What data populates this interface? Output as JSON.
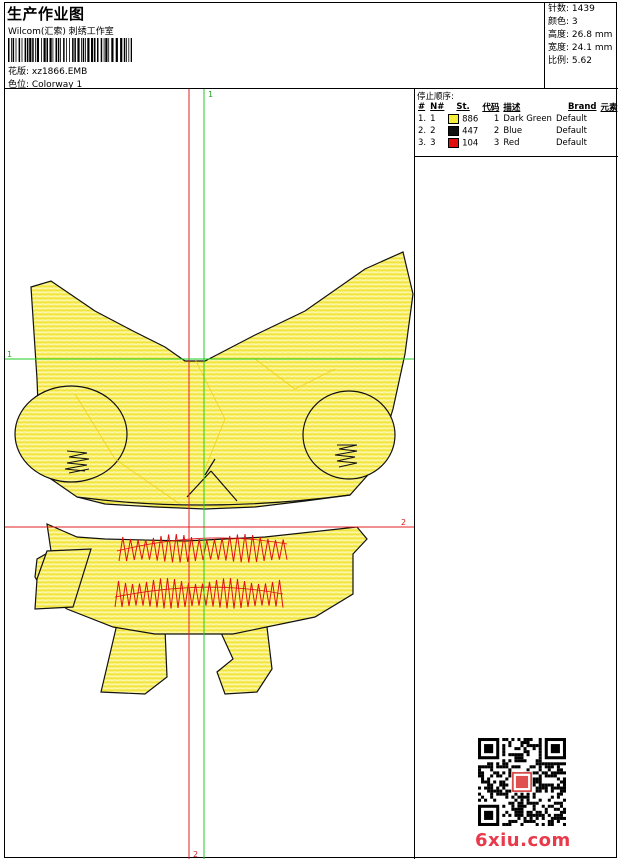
{
  "header": {
    "title": "生产作业图",
    "company": "Wilcom(汇索) 刺绣工作室",
    "design_line": "花版: xz1866.EMB",
    "colorway_line": "色位: Colorway 1"
  },
  "stats": [
    {
      "label": "针数",
      "value": "1439"
    },
    {
      "label": "颜色",
      "value": "3"
    },
    {
      "label": "高度",
      "value": "26.8 mm"
    },
    {
      "label": "宽度",
      "value": "24.1 mm"
    },
    {
      "label": "比例",
      "value": "5.62"
    }
  ],
  "stop_sequence": {
    "title": "停止顺序:",
    "columns": [
      "#",
      "N#",
      "St.",
      "代码",
      "描述",
      "Brand",
      "元素"
    ],
    "rows": [
      {
        "num": "1.",
        "n": "1",
        "color": "#f5ee3a",
        "st": "886",
        "code": "1",
        "desc": "Dark Green",
        "brand": "Default"
      },
      {
        "num": "2.",
        "n": "2",
        "color": "#111111",
        "st": "447",
        "code": "2",
        "desc": "Blue",
        "brand": "Default"
      },
      {
        "num": "3.",
        "n": "3",
        "color": "#e01010",
        "st": "104",
        "code": "3",
        "desc": "Red",
        "brand": "Default"
      }
    ]
  },
  "guides": {
    "label_1": "1",
    "label_2": "2"
  },
  "watermark": "6xiu.com",
  "colors": {
    "fill": "#f7ee6a",
    "stitch": "#f1e33a",
    "outline": "#111111",
    "accent_red": "#e01010",
    "guide_red": "#e02020",
    "guide_green": "#22cc22"
  }
}
